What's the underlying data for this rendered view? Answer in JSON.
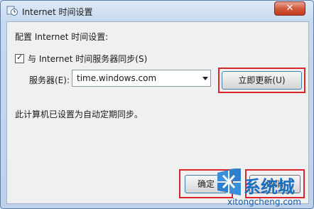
{
  "window": {
    "title": "Internet 时间设置",
    "close_glyph": "✕"
  },
  "dialog": {
    "heading": "配置 Internet 时间设置:",
    "sync_checkbox": {
      "checked": true,
      "label": "与 Internet 时间服务器同步(S)"
    },
    "server": {
      "label": "服务器(E):",
      "value": "time.windows.com"
    },
    "update_button": "立即更新(U)",
    "status": "此计算机已设置为自动定期同步。"
  },
  "buttons": {
    "ok": "确定",
    "cancel": "取消"
  },
  "watermark": {
    "brand": "系统城",
    "domain": "xitongcheng.com"
  },
  "colors": {
    "highlight": "#d9262b",
    "title_gradient": "#c6d9ee",
    "watermark_blue": "#1a6fc0"
  }
}
